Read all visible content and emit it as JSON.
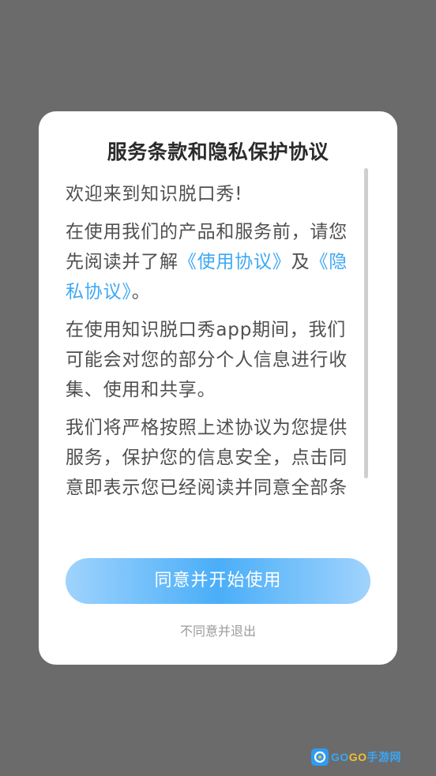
{
  "dialog": {
    "title": "服务条款和隐私保护协议",
    "paragraphs": {
      "p1": "欢迎来到知识脱口秀!",
      "p2_a": "在使用我们的产品和服务前，请您先阅读并了解",
      "p2_link1": "《使用协议》",
      "p2_b": "及",
      "p2_link2": "《隐私协议》",
      "p2_c": "。",
      "p3": "在使用知识脱口秀app期间，我们可能会对您的部分个人信息进行收集、使用和共享。",
      "p4": "我们将严格按照上述协议为您提供服务，保护您的信息安全，点击同意即表示您已经阅读并同意全部条"
    },
    "agree_label": "同意并开始使用",
    "disagree_label": "不同意并退出"
  },
  "watermark": {
    "text_a": "GO",
    "text_b": "GO",
    "text_c": "手游网",
    "icon": "gamepad-icon"
  },
  "colors": {
    "overlay": "#6b6b6b",
    "link": "#3ea8f3",
    "button_gradient_mid": "#4aaef8",
    "button_gradient_edge": "#9fd3fd"
  }
}
